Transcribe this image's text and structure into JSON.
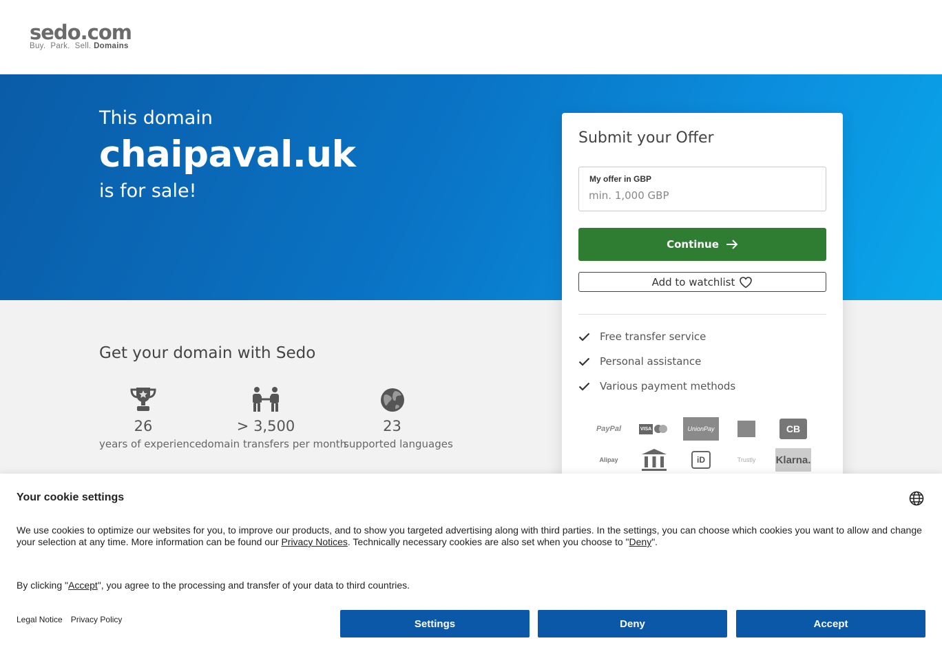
{
  "header": {
    "logo_main": "sedo.com",
    "logo_tag_plain": "Buy.  Park.  Sell.",
    "logo_tag_bold": "Domains"
  },
  "hero": {
    "pre": "This domain",
    "domain": "chaipaval.uk",
    "post": "is for sale!"
  },
  "stats": {
    "title": "Get your domain with Sedo",
    "items": [
      {
        "icon": "trophy-icon",
        "value": "26",
        "label": "years of experience"
      },
      {
        "icon": "transfer-icon",
        "value": "> 3,500",
        "label": "domain transfers per month"
      },
      {
        "icon": "globe-icon",
        "value": "23",
        "label": "supported languages"
      }
    ]
  },
  "offer": {
    "title": "Submit your Offer",
    "field_label": "My offer in GBP",
    "placeholder": "min. 1,000 GBP",
    "value": "",
    "continue_label": "Continue",
    "watchlist_label": "Add to watchlist",
    "features": [
      "Free transfer service",
      "Personal assistance",
      "Various payment methods"
    ],
    "payments": [
      {
        "name": "PayPal",
        "icon": "paypal-icon"
      },
      {
        "name": "VISA",
        "icon": "visa-mastercard-icon"
      },
      {
        "name": "UnionPay",
        "icon": "unionpay-icon"
      },
      {
        "name": "",
        "icon": "amex-icon"
      },
      {
        "name": "CB",
        "icon": "cb-icon"
      },
      {
        "name": "Alipay",
        "icon": "alipay-icon"
      },
      {
        "name": "",
        "icon": "bank-transfer-icon"
      },
      {
        "name": "iD",
        "icon": "ideal-icon"
      },
      {
        "name": "Trustly",
        "icon": "trustly-icon"
      },
      {
        "name": "Klarna.",
        "icon": "klarna-icon"
      }
    ]
  },
  "cookie": {
    "title": "Your cookie settings",
    "text_part1": "We use cookies to optimize our websites for you, to improve our products, and to show you targeted advertising along with third parties. In the settings, you can choose which cookies you want to allow and change your selection at any time. More information can be found our ",
    "privacy_notices_link": "Privacy Notices",
    "text_part2": ". Technically necessary cookies are also set when you choose to \"",
    "deny_link": "Deny",
    "text_part3": "\".",
    "accept_text_part1": "By clicking \"",
    "accept_link": "Accept",
    "accept_text_part2": "\", you agree to the processing and transfer of your data to third countries.",
    "legal_notice": "Legal Notice",
    "privacy_policy": "Privacy Policy",
    "settings_label": "Settings",
    "deny_label": "Deny",
    "accept_label": "Accept"
  },
  "colors": {
    "hero_start": "#0a5ca7",
    "hero_end": "#0aa7ea",
    "continue_green": "#2e7d32",
    "cookie_button_blue": "#0b57a8"
  }
}
